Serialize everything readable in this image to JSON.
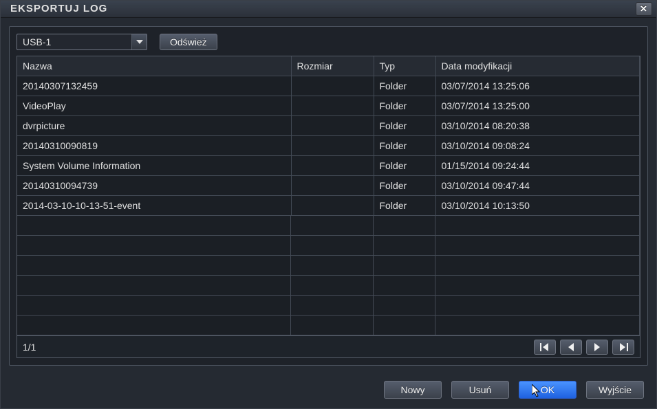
{
  "title": "EKSPORTUJ LOG",
  "close_label": "✕",
  "toolbar": {
    "drive_selected": "USB-1",
    "refresh_label": "Odśwież"
  },
  "columns": {
    "name": "Nazwa",
    "size": "Rozmiar",
    "type": "Typ",
    "date": "Data modyfikacji"
  },
  "rows": [
    {
      "name": "20140307132459",
      "size": "",
      "type": "Folder",
      "date": "03/07/2014 13:25:06"
    },
    {
      "name": "VideoPlay",
      "size": "",
      "type": "Folder",
      "date": "03/07/2014 13:25:00"
    },
    {
      "name": "dvrpicture",
      "size": "",
      "type": "Folder",
      "date": "03/10/2014 08:20:38"
    },
    {
      "name": "20140310090819",
      "size": "",
      "type": "Folder",
      "date": "03/10/2014 09:08:24"
    },
    {
      "name": "System Volume Information",
      "size": "",
      "type": "Folder",
      "date": "01/15/2014 09:24:44"
    },
    {
      "name": "20140310094739",
      "size": "",
      "type": "Folder",
      "date": "03/10/2014 09:47:44"
    },
    {
      "name": "2014-03-10-10-13-51-event",
      "size": "",
      "type": "Folder",
      "date": "03/10/2014 10:13:50"
    }
  ],
  "empty_row_count": 6,
  "pagination": {
    "label": "1/1"
  },
  "buttons": {
    "new": "Nowy",
    "delete": "Usuń",
    "ok": "OK",
    "exit": "Wyjście"
  },
  "col_widths": {
    "name": 398,
    "size": 120,
    "type": 90
  }
}
